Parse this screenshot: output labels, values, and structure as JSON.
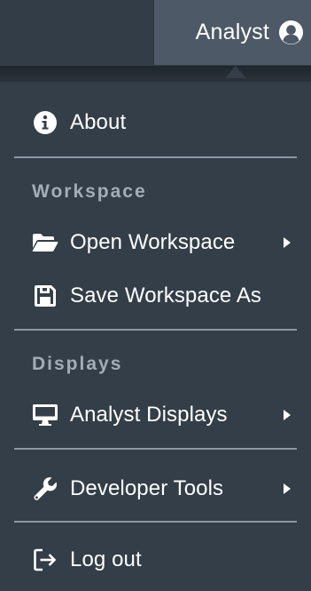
{
  "header": {
    "user_label": "Analyst",
    "user_icon": "user-circle-icon"
  },
  "menu": {
    "about": {
      "label": "About",
      "icon": "info-circle-icon"
    },
    "workspace_header": "Workspace",
    "open_workspace": {
      "label": "Open Workspace",
      "icon": "folder-open-icon",
      "has_submenu": true
    },
    "save_workspace_as": {
      "label": "Save Workspace As",
      "icon": "save-icon"
    },
    "displays_header": "Displays",
    "analyst_displays": {
      "label": "Analyst Displays",
      "icon": "desktop-icon",
      "has_submenu": true
    },
    "developer_tools": {
      "label": "Developer Tools",
      "icon": "wrench-icon",
      "has_submenu": true
    },
    "log_out": {
      "label": "Log out",
      "icon": "sign-out-icon"
    }
  },
  "colors": {
    "background": "#343e48",
    "header_button": "#4d5966",
    "section_header": "#a3adb7",
    "divider": "#8b96a1",
    "text": "#ffffff"
  }
}
